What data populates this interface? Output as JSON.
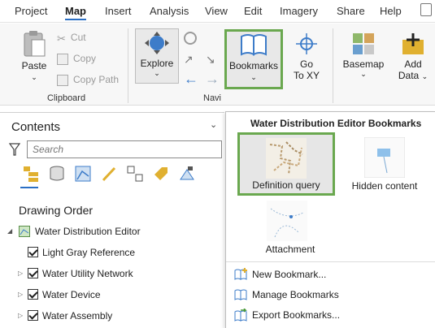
{
  "menubar": {
    "tabs": [
      "Project",
      "Map",
      "Insert",
      "Analysis",
      "View",
      "Edit",
      "Imagery",
      "Share",
      "Help"
    ],
    "active": "Map"
  },
  "ribbon": {
    "clipboard": {
      "paste_label": "Paste",
      "cut_label": "Cut",
      "copy_label": "Copy",
      "copy_path_label": "Copy Path",
      "group_label": "Clipboard"
    },
    "navigate": {
      "explore_label": "Explore",
      "group_label": "Navi",
      "bookmarks_label": "Bookmarks",
      "goto_label_1": "Go",
      "goto_label_2": "To XY"
    },
    "layer": {
      "basemap_label": "Basemap",
      "add_data_label_1": "Add",
      "add_data_label_2": "Data"
    }
  },
  "contents": {
    "title": "Contents",
    "search_placeholder": "Search",
    "drawing_order_label": "Drawing Order",
    "map_name": "Water Distribution Editor",
    "layers": [
      {
        "label": "Light Gray Reference",
        "checked": true,
        "expandable": false
      },
      {
        "label": "Water Utility Network",
        "checked": true,
        "expandable": true
      },
      {
        "label": "Water Device",
        "checked": true,
        "expandable": true
      },
      {
        "label": "Water Assembly",
        "checked": true,
        "expandable": true
      }
    ]
  },
  "bookmarks_menu": {
    "title": "Water Distribution Editor Bookmarks",
    "bookmarks": [
      {
        "label": "Definition query",
        "selected": true
      },
      {
        "label": "Hidden content",
        "selected": false
      },
      {
        "label": "Attachment",
        "selected": false
      }
    ],
    "actions": [
      "New Bookmark...",
      "Manage Bookmarks",
      "Export Bookmarks..."
    ]
  },
  "colors": {
    "highlight_border": "#6aa84f",
    "active_tab_underline": "#2b6fc4",
    "icon_blue": "#3d7cc9",
    "icon_gold": "#e0b030"
  }
}
